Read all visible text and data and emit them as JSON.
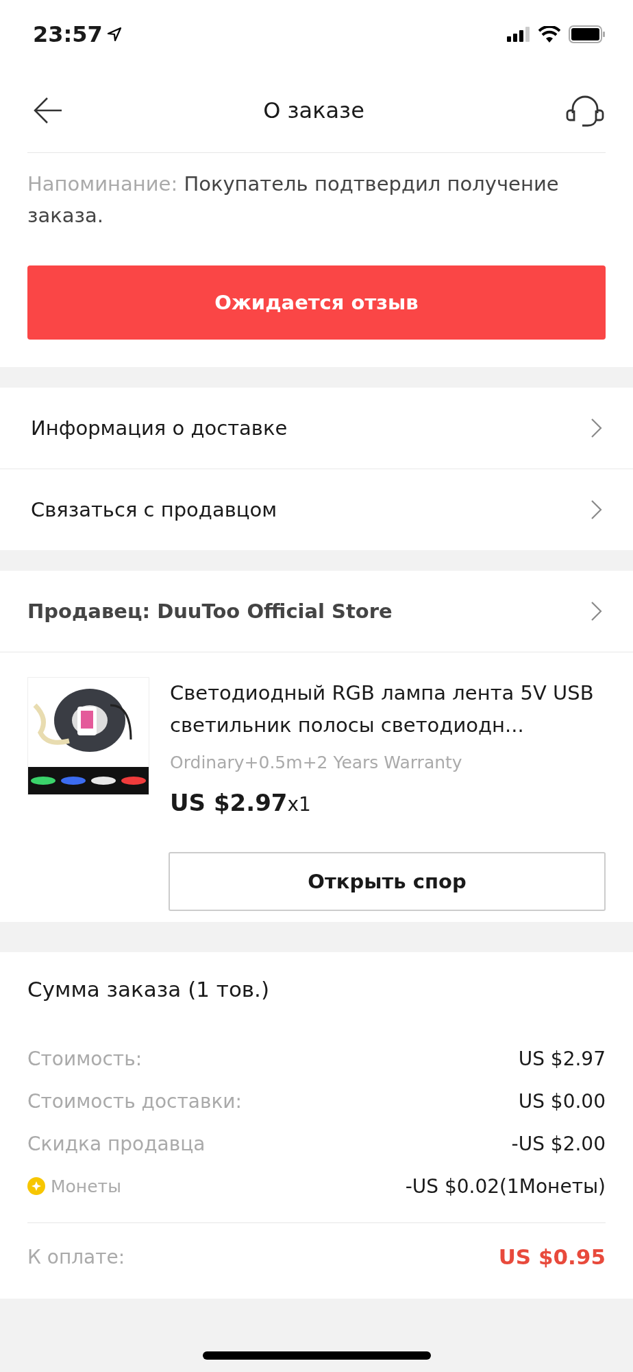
{
  "status_bar": {
    "time": "23:57"
  },
  "header": {
    "title": "О заказе"
  },
  "reminder": {
    "label": "Напоминание:",
    "text": "Покупатель подтвердил получение заказа."
  },
  "primary_button": "Ожидается отзыв",
  "links": [
    "Информация о доставке",
    "Связаться с продавцом"
  ],
  "seller": {
    "text": "Продавец: DuuToo Official Store"
  },
  "product": {
    "title": "Светодиодный RGB лампа лента 5V USB светильник полосы светодиодн...",
    "variant": "Ordinary+0.5m+2 Years Warranty",
    "price": "US $2.97",
    "quantity": "x1",
    "dispute_button": "Открыть спор"
  },
  "summary": {
    "title": "Сумма заказа (1 тов.)",
    "rows": [
      {
        "kind": "plain",
        "label": "Стоимость:",
        "value": "US $2.97"
      },
      {
        "kind": "plain",
        "label": "Стоимость доставки:",
        "value": "US $0.00"
      },
      {
        "kind": "plain",
        "label": "Скидка продавца",
        "value": "-US $2.00"
      },
      {
        "kind": "coins",
        "label": "Монеты",
        "value": "-US $0.02(1Монеты)"
      }
    ],
    "total": {
      "label": "К оплате:",
      "value": "US $0.95"
    }
  }
}
